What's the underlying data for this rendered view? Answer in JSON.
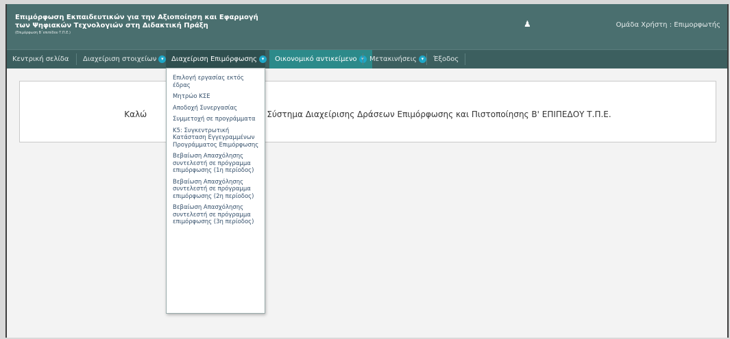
{
  "header": {
    "title_line1": "Επιμόρφωση Εκπαιδευτικών για την Αξιοποίηση και Εφαρμογή",
    "title_line2": "των Ψηφιακών Τεχνολογιών στη Διδακτική Πράξη",
    "title_line3": "(Επιμόρφωση Β΄επιπέδου Τ.Π.Ε.)",
    "user_icon": "user-icon",
    "user_group": "Ομάδα Χρήστη : Επιμορφωτής"
  },
  "nav": {
    "home": "Κεντρική σελίδα",
    "data_management": "Διαχείριση στοιχείων",
    "training_management": "Διαχείριση Επιμόρφωσης",
    "financial": "Οικονομικό αντικείμενο",
    "travel": "Μετακινήσεις",
    "exit": "Έξοδος",
    "caret": "▾"
  },
  "dropdown": {
    "items": [
      "Επιλογή εργασίας εκτός έδρας",
      "Μητρώο ΚΣΕ",
      "Αποδοχή Συνεργασίας",
      "Συμμετοχή σε προγράμματα",
      "Κ5: Συγκεντρωτική Κατάσταση Εγγεγραμμένων Προγράμματος Επιμόρφωσης",
      "Βεβαίωση Απασχόλησης συντελεστή σε πρόγραμμα επιμόρφωσης (1η περίοδος)",
      "Βεβαίωση Απασχόλησης συντελεστή σε πρόγραμμα επιμόρφωσης (2η περίοδος)",
      "Βεβαίωση Απασχόλησης συντελεστή σε πρόγραμμα επιμόρφωσης (3η περίοδος)"
    ]
  },
  "main": {
    "welcome_left": "Καλώ",
    "welcome_right": "ακό Σύστημα Διαχείρισης Δράσεων Επιμόρφωσης και Πιστοποίησης Β' ΕΠΙΠΕΔΟΥ Τ.Π.Ε."
  },
  "colors": {
    "header_bg": "#4a6f6f",
    "nav_bg": "#3c5f5f",
    "nav_highlight": "#2c8a8a",
    "caret": "#1ea6c6"
  }
}
